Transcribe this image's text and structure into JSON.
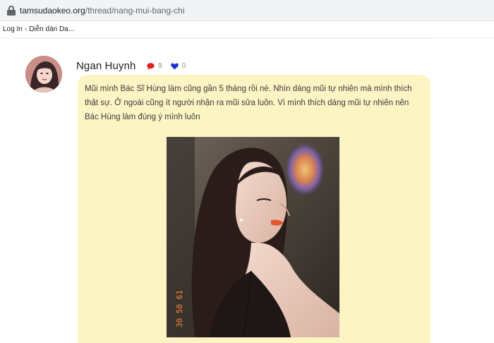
{
  "browser": {
    "url_host": "tamsudaokeo.org",
    "url_path": "/thread/nang-mui-bang-chi"
  },
  "breadcrumb": {
    "login": "Log In",
    "separator": "‹",
    "forum": "Diễn dàn Da..."
  },
  "post": {
    "author": "Ngan Huynh",
    "comment_count": "9",
    "like_count": "0",
    "body": "Mũi mình Bác Sĩ Hùng làm cũng gần 5 tháng rồi nè. Nhìn dáng mũi tự nhiên mà mình thích thật sự. Ở ngoài cũng ít người nhận ra mũi sửa luôn. Vì mình thích dáng mũi tự nhiên nên Bác Hùng làm đúng ý mình luôn",
    "photo_stamp": "30 50 61"
  },
  "colors": {
    "bubble": "#fdf4c4",
    "comment_icon": "#e02020",
    "heart_icon": "#1a2fd6"
  }
}
